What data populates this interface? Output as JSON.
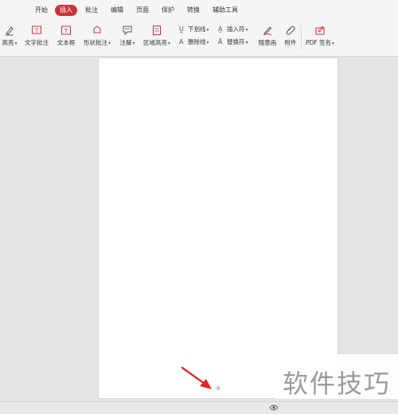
{
  "menu": {
    "tabs": [
      "开始",
      "插入",
      "批注",
      "编辑",
      "页面",
      "保护",
      "转换",
      "辅助工具"
    ],
    "active_tab": "插入"
  },
  "ribbon": {
    "highlight": "高亮",
    "text_comment": "文字批注",
    "text_box": "文本框",
    "shape_comment": "形状批注",
    "note": "注解",
    "area_highlight": "区域高亮",
    "underline": "下划线",
    "strikethrough": "删除线",
    "insert_mark": "插入符",
    "replace_mark": "替换符",
    "freehand": "随意画",
    "attachment": "附件",
    "pdf_sign": "PDF 签名"
  },
  "document": {
    "page_marker": "①"
  },
  "watermark": {
    "text": "软件技巧"
  },
  "colors": {
    "accent": "#c9343b",
    "arrow": "#e0262b",
    "background": "#e4e4e4",
    "toolbar": "#f5f5f5"
  },
  "icons": [
    "highlight-icon",
    "text-comment-icon",
    "text-box-icon",
    "shape-comment-icon",
    "note-icon",
    "area-highlight-icon",
    "underline-icon",
    "strikethrough-icon",
    "insert-mark-icon",
    "replace-mark-icon",
    "freehand-icon",
    "attachment-icon",
    "pdf-sign-icon",
    "eye-icon"
  ]
}
